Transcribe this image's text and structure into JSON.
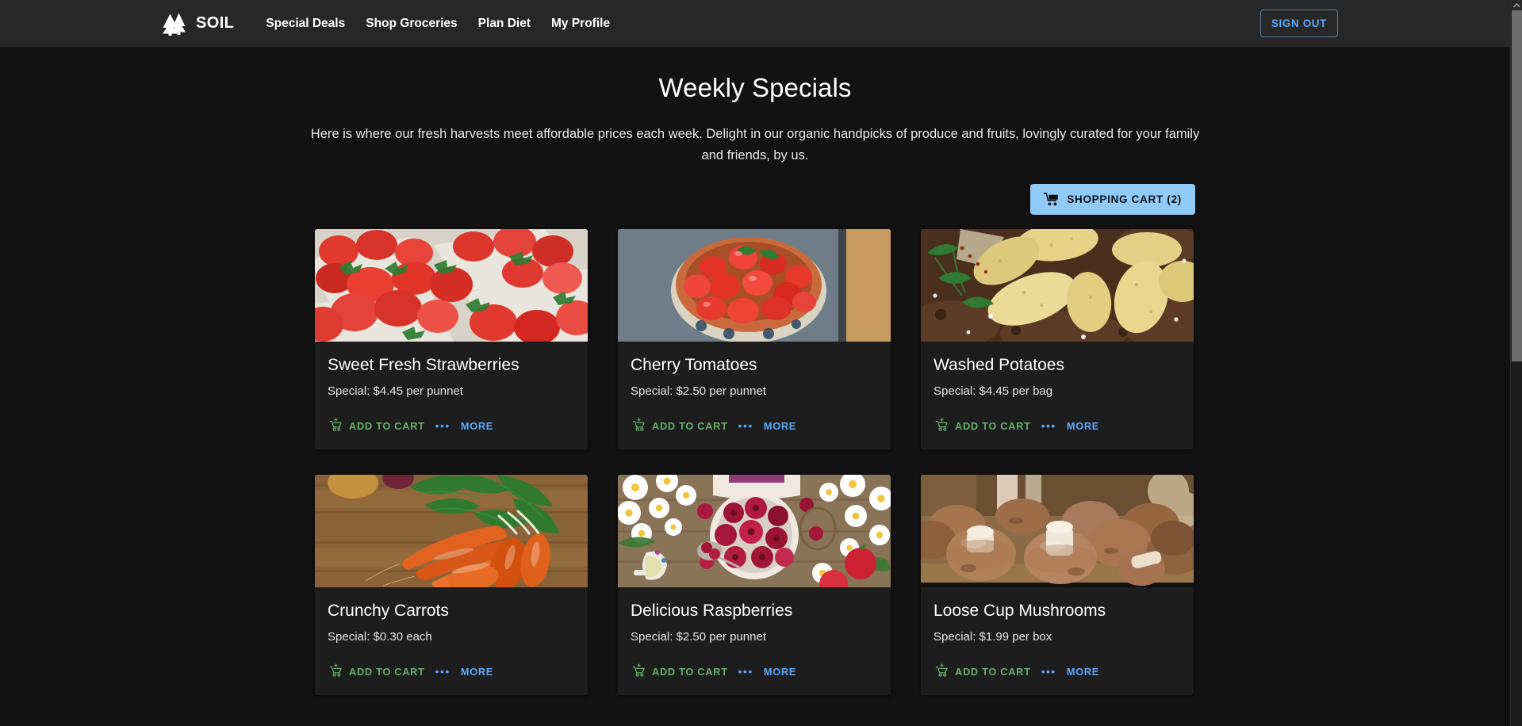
{
  "navbar": {
    "logo_icon": "two-pine-trees-icon",
    "brand": "SOIL",
    "links": [
      {
        "label": "Special Deals"
      },
      {
        "label": "Shop Groceries"
      },
      {
        "label": "Plan Diet"
      },
      {
        "label": "My Profile"
      }
    ],
    "signout_label": "SIGN OUT"
  },
  "main": {
    "title": "Weekly Specials",
    "description": "Here is where our fresh harvests meet affordable prices each week. Delight in our organic handpicks of produce and fruits, lovingly curated for your family and friends, by us.",
    "cart_icon": "shopping-cart-icon",
    "cart_label": "SHOPPING CART (2)",
    "cart_count": 2,
    "add_to_cart_label": "ADD TO CART",
    "more_label": "MORE",
    "overflow_glyph": "•••",
    "add_icon": "cart-plus-icon",
    "products": [
      {
        "title": "Sweet Fresh Strawberries",
        "special": "Special: $4.45 per punnet",
        "image_alt": "strawberries-in-punnets-image"
      },
      {
        "title": "Cherry Tomatoes",
        "special": "Special: $2.50 per punnet",
        "image_alt": "cherry-tomatoes-in-bowl-image"
      },
      {
        "title": "Washed Potatoes",
        "special": "Special: $4.45 per bag",
        "image_alt": "washed-potatoes-on-soil-image"
      },
      {
        "title": "Crunchy Carrots",
        "special": "Special: $0.30 each",
        "image_alt": "carrots-on-wooden-table-image"
      },
      {
        "title": "Delicious Raspberries",
        "special": "Special: $2.50 per punnet",
        "image_alt": "raspberries-bowl-with-daisies-image"
      },
      {
        "title": "Loose Cup Mushrooms",
        "special": "Special: $1.99 per box",
        "image_alt": "cup-mushrooms-on-board-image"
      }
    ]
  },
  "colors": {
    "page_bg": "#121212",
    "navbar_bg": "#272727",
    "card_bg": "#1d1d1d",
    "accent_blue": "#5aa9ff",
    "cart_button_bg": "#90caf9",
    "add_green": "#63b168"
  }
}
